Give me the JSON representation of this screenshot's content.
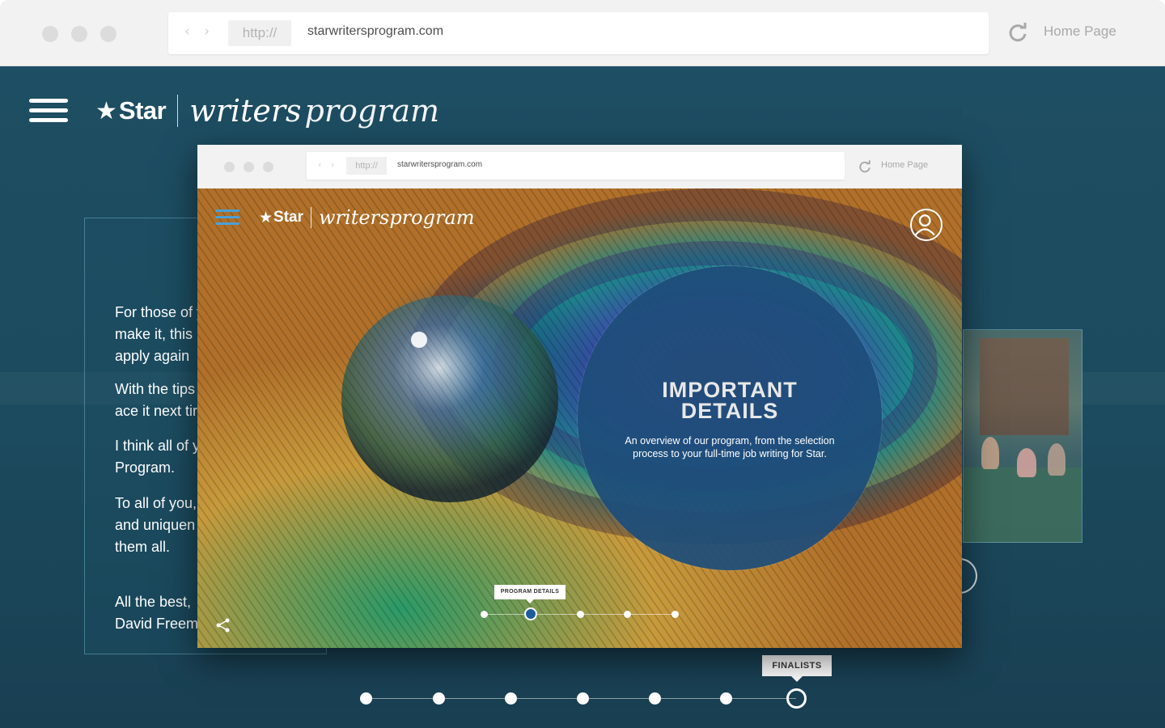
{
  "outer_browser": {
    "protocol": "http://",
    "url": "starwritersprogram.com",
    "home_link": "Home Page",
    "nav_arrows": "‹ ›"
  },
  "brand": {
    "star_glyph": "★",
    "name": "Star",
    "word1": "writers",
    "word2": "program"
  },
  "letter_card": {
    "paragraphs": [
      "For those of y\nmake it, this\napply again",
      "With the tips\nace it next tir",
      "I think all of y\nProgram.",
      "To all of you,\nand uniquen\nthem all.",
      "All the best,\nDavid Freem"
    ]
  },
  "outer_timeline": {
    "tooltip": "FINALISTS",
    "step_count": 7,
    "active_step": 7
  },
  "inner_browser": {
    "protocol": "http://",
    "url": "starwritersprogram.com",
    "home_link": "Home Page",
    "nav_arrows": "‹ ›",
    "brand": {
      "star_glyph": "★",
      "name": "Star",
      "word1": "writers",
      "word2": "program"
    },
    "hero_card": {
      "title_line1": "IMPORTANT",
      "title_line2": "DETAILS",
      "description": "An overview of our program, from the selection process to your full-time job writing for Star."
    },
    "timeline": {
      "tooltip": "PROGRAM DETAILS",
      "step_count": 5,
      "active_step": 2
    }
  },
  "colors": {
    "page_bg": "#1e4e63",
    "circle_bg": "#1e4e7a",
    "chrome_bg": "#f2f2f2",
    "accent_blue": "#1e5d9a"
  },
  "icons": {
    "menu": "hamburger-icon",
    "reload": "reload-icon",
    "avatar": "user-avatar-icon",
    "share": "share-icon",
    "star": "star-icon"
  }
}
